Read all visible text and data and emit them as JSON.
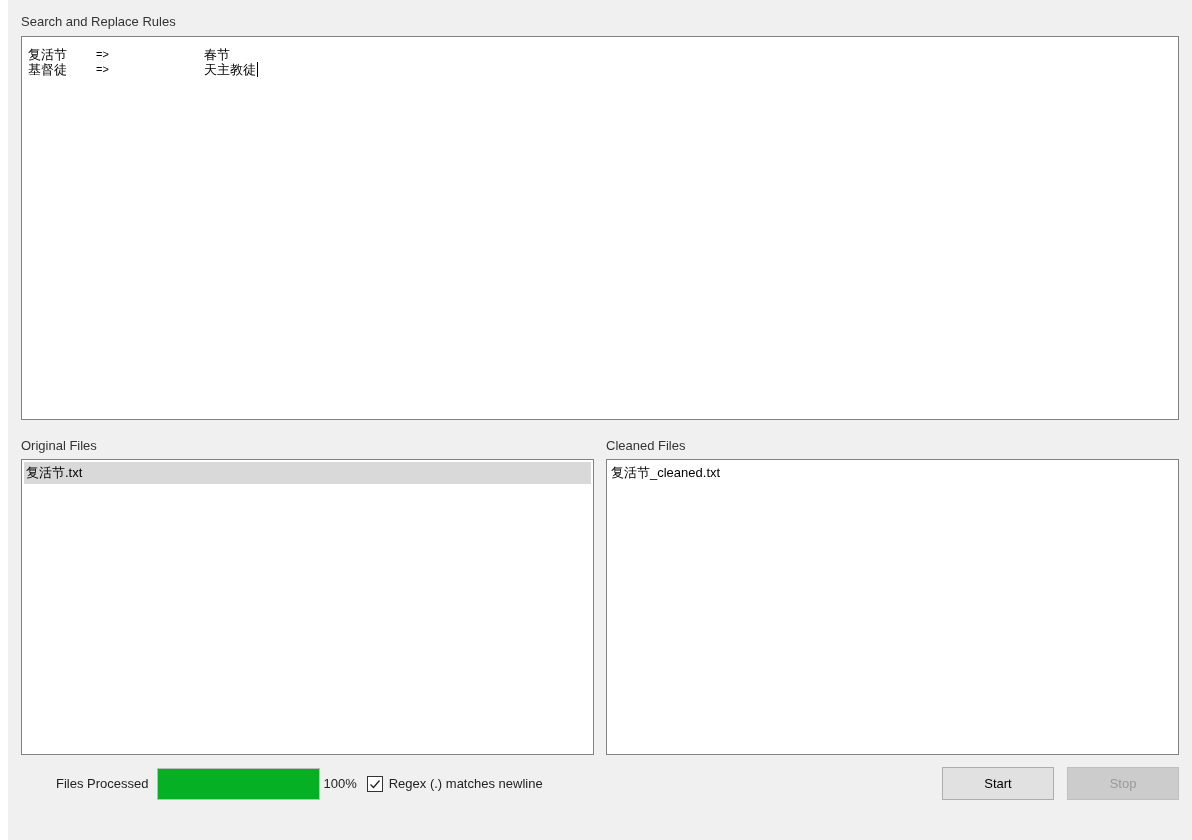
{
  "rules_label": "Search and Replace Rules",
  "rules": [
    {
      "search": "复活节",
      "arrow": "=>",
      "replace": "春节"
    },
    {
      "search": "基督徒",
      "arrow": "=>",
      "replace": "天主教徒"
    }
  ],
  "original_files": {
    "label": "Original Files",
    "items": [
      {
        "name": "复活节.txt",
        "selected": true
      }
    ]
  },
  "cleaned_files": {
    "label": "Cleaned Files",
    "items": [
      {
        "name": "复活节_cleaned.txt",
        "selected": false
      }
    ]
  },
  "progress": {
    "label": "Files Processed",
    "level": 1,
    "reading": "100%"
  },
  "regex_option": {
    "label": "Regex (.) matches newline",
    "checked": true
  },
  "buttons": [
    {
      "label": "Start",
      "disabled": false
    },
    {
      "label": "Stop",
      "disabled": true
    }
  ]
}
